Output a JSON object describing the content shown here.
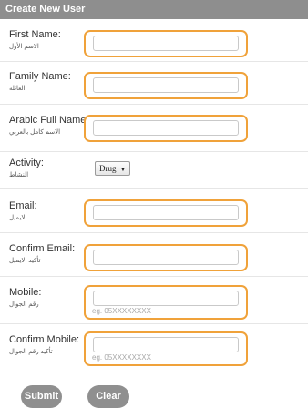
{
  "header": {
    "title": "Create New User"
  },
  "fields": [
    {
      "label_en": "First Name:",
      "label_ar": "الاسم الأول",
      "value": "",
      "hint": ""
    },
    {
      "label_en": "Family Name:",
      "label_ar": "العائلة",
      "value": "",
      "hint": ""
    },
    {
      "label_en": "Arabic Full Name:",
      "label_ar": "الاسم كامل بالعربي",
      "value": "",
      "hint": ""
    },
    {
      "label_en": "Activity:",
      "label_ar": "النشاط",
      "selected": "Drug"
    },
    {
      "label_en": "Email:",
      "label_ar": "الايميل",
      "value": "",
      "hint": ""
    },
    {
      "label_en": "Confirm Email:",
      "label_ar": "تأكيد الايميل",
      "value": "",
      "hint": ""
    },
    {
      "label_en": "Mobile:",
      "label_ar": "رقم الجوال",
      "value": "",
      "hint": "eg. 05XXXXXXXX"
    },
    {
      "label_en": "Confirm Mobile:",
      "label_ar": "تأكيد رقم الجوال",
      "value": "",
      "hint": "eg. 05XXXXXXXX"
    }
  ],
  "buttons": {
    "submit": "Submit",
    "clear": "Clear"
  },
  "colors": {
    "header_bg": "#8e8e8e",
    "field_border": "#f0a23a",
    "button_bg": "#8f8f8f"
  }
}
